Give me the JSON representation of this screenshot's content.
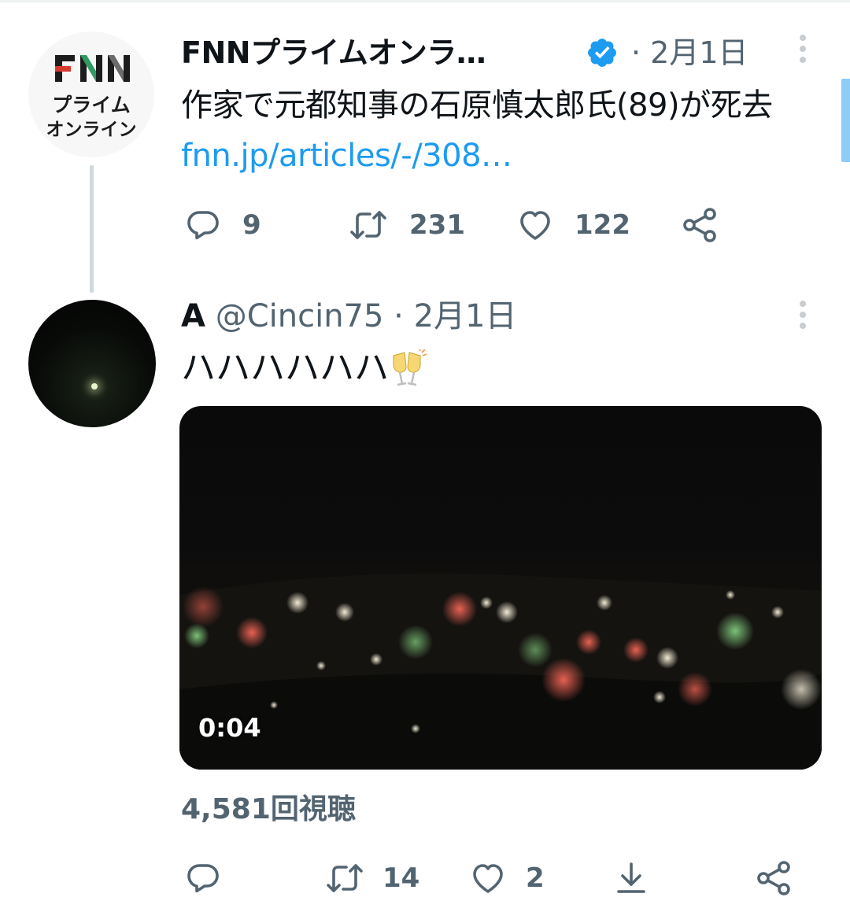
{
  "tweets": [
    {
      "display_name": "FNNプライムオンラ…",
      "time": "· 2月1日",
      "text": "作家で元都知事の石原慎太郎氏(89)が死去",
      "link": "fnn.jp/articles/-/308…",
      "avatar_logo": {
        "line1": "FNN",
        "line2": "プライム",
        "line3": "オンライン"
      },
      "stats": {
        "replies": "9",
        "retweets": "231",
        "likes": "122"
      }
    },
    {
      "display_name": "A",
      "handle": "@Cincin75",
      "time": "· 2月1日",
      "text": "ハハハハハハ",
      "emoji": "clinking-glasses",
      "video": {
        "duration": "0:04"
      },
      "views": "4,581回視聴",
      "stats": {
        "retweets": "14",
        "likes": "2"
      }
    }
  ],
  "colors": {
    "text": "#0f1419",
    "secondary": "#536471",
    "link": "#1d9bf0",
    "verified": "#1d9bf0",
    "fnn_red": "#d63a2f",
    "fnn_green": "#2f9a62",
    "fnn_dark": "#1c1c1c"
  }
}
